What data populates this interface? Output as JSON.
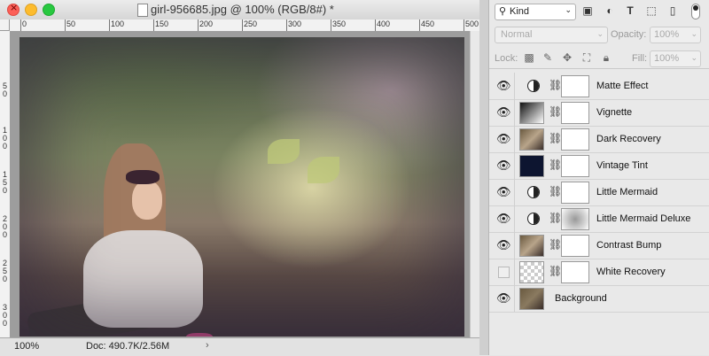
{
  "document": {
    "title": "girl-956685.jpg @ 100% (RGB/8#) *",
    "zoom": "100%",
    "doc_size": "Doc: 490.7K/2.56M",
    "status_arrow": "›",
    "ruler_h_labels": [
      "0",
      "50",
      "100",
      "150",
      "200",
      "250",
      "300",
      "350",
      "400",
      "450",
      "500"
    ],
    "ruler_v_labels": [
      "5\n0",
      "1\n0\n0",
      "1\n5\n0",
      "2\n0\n0",
      "2\n5\n0",
      "3\n0\n0"
    ]
  },
  "layers_panel": {
    "filter_kind": "Kind",
    "filter_icons": [
      "image-filter-icon",
      "adjustment-filter-icon",
      "type-filter-icon",
      "shape-filter-icon",
      "smart-object-filter-icon"
    ],
    "blend_mode": "Normal",
    "opacity_label": "Opacity:",
    "opacity_value": "100%",
    "lock_label": "Lock:",
    "fill_label": "Fill:",
    "fill_value": "100%",
    "layers": [
      {
        "name": "Matte Effect",
        "visible": true,
        "type": "adjustment"
      },
      {
        "name": "Vignette",
        "visible": true,
        "type": "gradient"
      },
      {
        "name": "Dark Recovery",
        "visible": true,
        "type": "image"
      },
      {
        "name": "Vintage Tint",
        "visible": true,
        "type": "solid",
        "color": "#0d1530"
      },
      {
        "name": "Little Mermaid",
        "visible": true,
        "type": "adjustment"
      },
      {
        "name": "Little Mermaid Deluxe",
        "visible": true,
        "type": "adjustment-masked"
      },
      {
        "name": "Contrast Bump",
        "visible": true,
        "type": "image"
      },
      {
        "name": "White Recovery",
        "visible": false,
        "type": "transparent"
      },
      {
        "name": "Background",
        "visible": true,
        "type": "background"
      }
    ]
  }
}
